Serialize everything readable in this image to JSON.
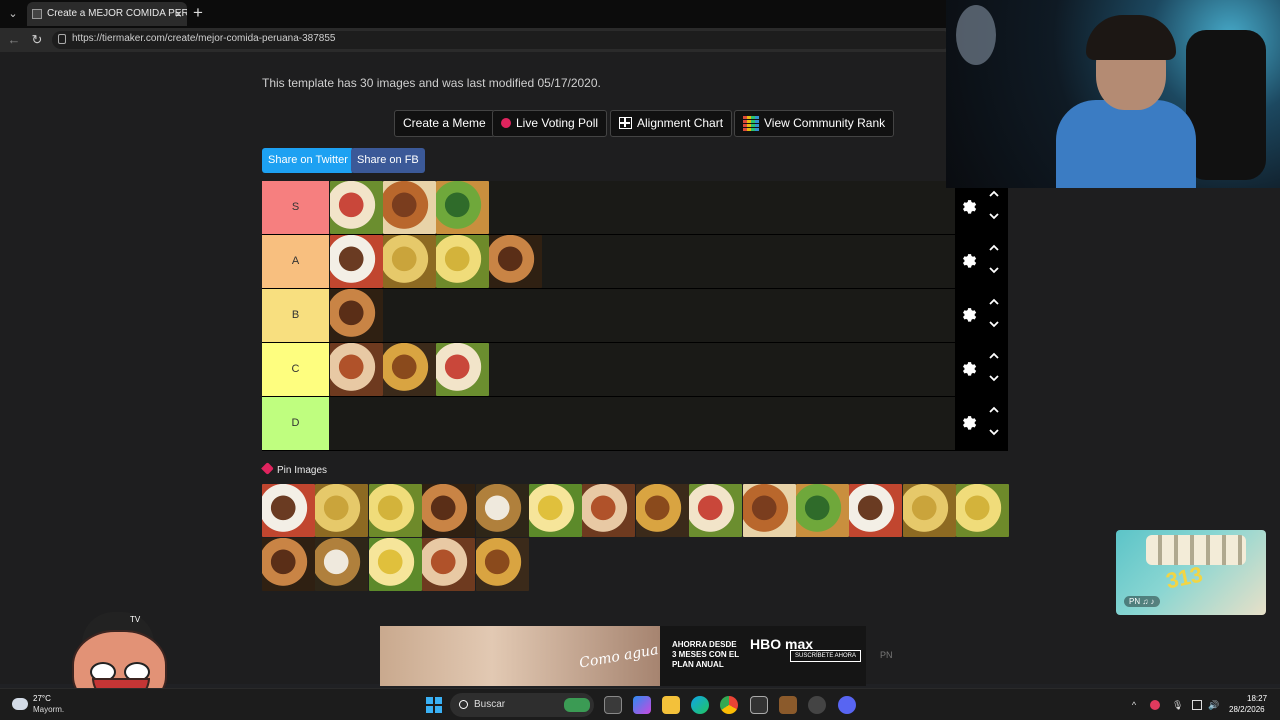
{
  "browser": {
    "tab_title": "Create a MEJOR COMIDA PERUANA",
    "tab_close": "×",
    "new_tab": "+",
    "url": "https://tiermaker.com/create/mejor-comida-peruana-387855",
    "back": "←",
    "reload": "↻"
  },
  "page": {
    "meta_text": "This template has 30 images and was last modified 05/17/2020.",
    "actions": {
      "create_meme": "Create a Meme",
      "live_voting": "Live Voting Poll",
      "alignment_chart": "Alignment Chart",
      "community_rank": "View Community Rank"
    },
    "share": {
      "twitter": "Share on Twitter",
      "facebook": "Share on FB"
    },
    "tiers": [
      {
        "label": "S",
        "color": "#f67f7f",
        "items": [
          "roast-chicken",
          "ceviche-plate",
          "anticuchos-skewers"
        ]
      },
      {
        "label": "A",
        "color": "#f8bf7f",
        "items": [
          "tallarines-verdes",
          "lomo-saltado",
          "arroz-con-mariscos",
          "aji-de-gallina"
        ]
      },
      {
        "label": "B",
        "color": "#f8df7f",
        "items": [
          "empanada"
        ]
      },
      {
        "label": "C",
        "color": "#fefe7f",
        "items": [
          "arroz-chaufa",
          "papas-huancaina",
          "cuy-roast"
        ]
      },
      {
        "label": "D",
        "color": "#bffe7f",
        "items": []
      }
    ],
    "pin_images_label": "Pin Images",
    "pool_items": [
      "causa-roll",
      "beef-heart",
      "burger",
      "tacu-tacu",
      "chicharron",
      "tamal",
      "papas-fritas",
      "cau-cau",
      "sanguche",
      "causa-limena",
      "pachamanca",
      "picarones",
      "carapulcra",
      "chupe",
      "rocoto-relleno",
      "seco-de-res",
      "tallarines",
      "pasta-verde",
      "adobo"
    ]
  },
  "ad": {
    "script_text": "Como agua para Chocolate",
    "offer": "AHORRA DESDE 3 MESES CON EL PLAN ANUAL",
    "brand": "HBO max",
    "cta": "SUSCRÍBETE AHORA",
    "pn": "PN"
  },
  "overlays": {
    "pool_cam_number": "313",
    "pepe_label": "TV"
  },
  "taskbar": {
    "temperature": "27°C",
    "weather": "Mayorm.",
    "search_placeholder": "Buscar",
    "time": "18:27",
    "date": "28/2/2026"
  },
  "colors": {
    "twitter": "#1da1f2",
    "facebook": "#3b5998",
    "live_dot": "#e0245e"
  }
}
